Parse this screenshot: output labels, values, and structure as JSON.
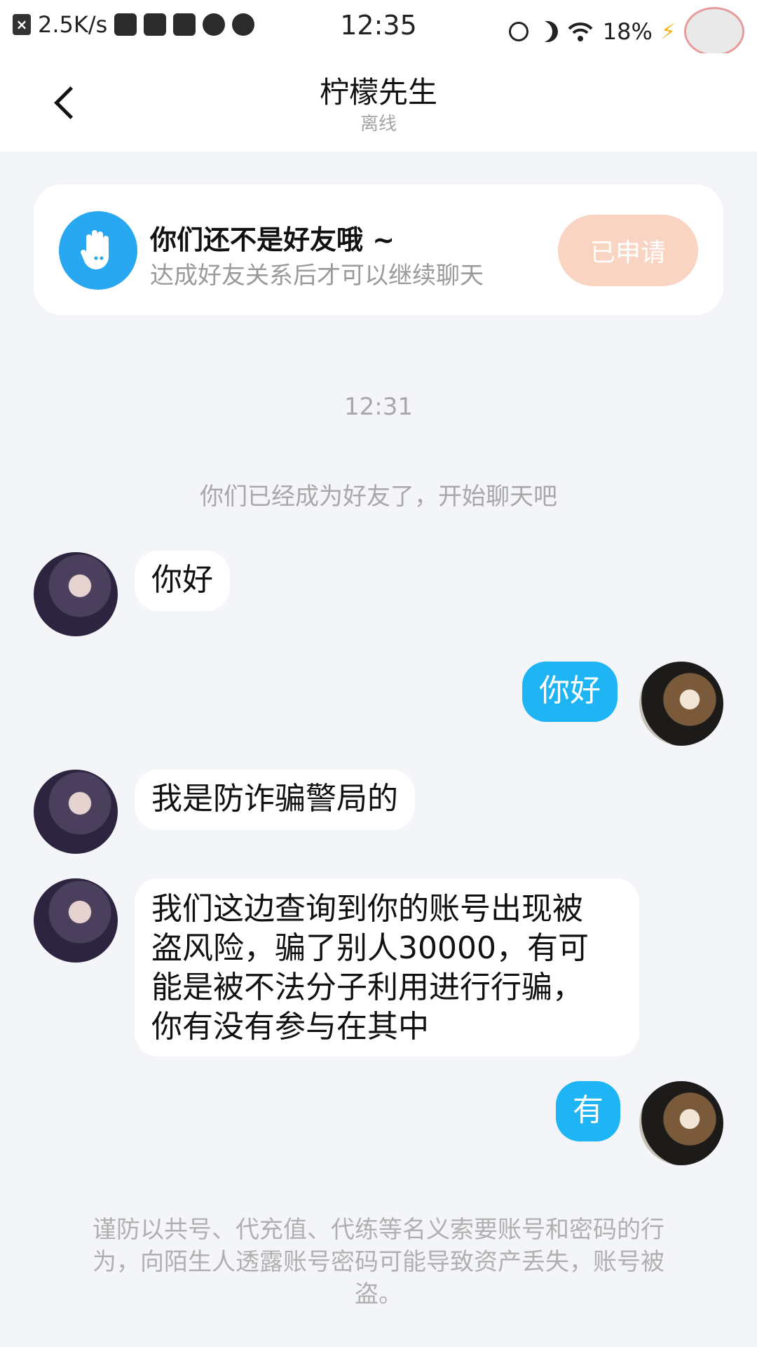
{
  "status_bar": {
    "network_rate": "2.5K/s",
    "time": "12:35",
    "battery": "18%",
    "icons": [
      "x-box-icon",
      "no-sim-icon",
      "video-icon",
      "inbox-icon",
      "planet-icon",
      "play-icon",
      "alarm-icon",
      "moon-icon",
      "wifi-icon",
      "bolt-icon",
      "profile-avatar"
    ]
  },
  "header": {
    "title": "柠檬先生",
    "status": "离线"
  },
  "friend_card": {
    "title": "你们还不是好友哦 ~",
    "subtitle": "达成好友关系后才可以继续聊天",
    "button": "已申请",
    "icon": "waving-hand-icon",
    "accent": "#29a8f2"
  },
  "chat": {
    "timestamp": "12:31",
    "system_message": "你们已经成为好友了，开始聊天吧",
    "messages": [
      {
        "side": "left",
        "text": "你好"
      },
      {
        "side": "right",
        "text": "你好"
      },
      {
        "side": "left",
        "text": "我是防诈骗警局的"
      },
      {
        "side": "left",
        "lines": [
          "我们这边查询到你的账号出现被",
          "盗风险，骗了别人30000，有可",
          "能是被不法分子利用进行行骗，",
          "你有没有参与在其中"
        ]
      },
      {
        "side": "right",
        "text": "有"
      }
    ]
  },
  "warning": {
    "lines": [
      "谨防以共号、代充值、代练等名义索要账号和密码的行",
      "为，向陌生人透露账号密码可能导致资产丢失，账号被",
      "盗。"
    ]
  },
  "colors": {
    "background": "#f3f5f8",
    "bubble_right": "#1fb4f3",
    "button_applied": "#f9d4c3"
  }
}
